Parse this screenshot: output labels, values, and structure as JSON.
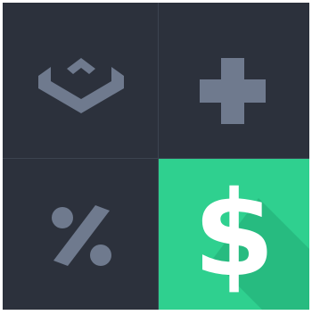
{
  "colors": {
    "tile_bg": "#2c313c",
    "grid_line": "#3c4350",
    "icon_gray": "#6f7a8e",
    "active_bg": "#2fd08f",
    "active_shadow": "#23ad76",
    "active_fg": "#ffffff"
  },
  "tiles": [
    {
      "icon": "layers-icon",
      "active": false
    },
    {
      "icon": "plus-icon",
      "active": false
    },
    {
      "icon": "percent-icon",
      "active": false
    },
    {
      "icon": "dollar-icon",
      "active": true,
      "glyph": "$"
    }
  ]
}
